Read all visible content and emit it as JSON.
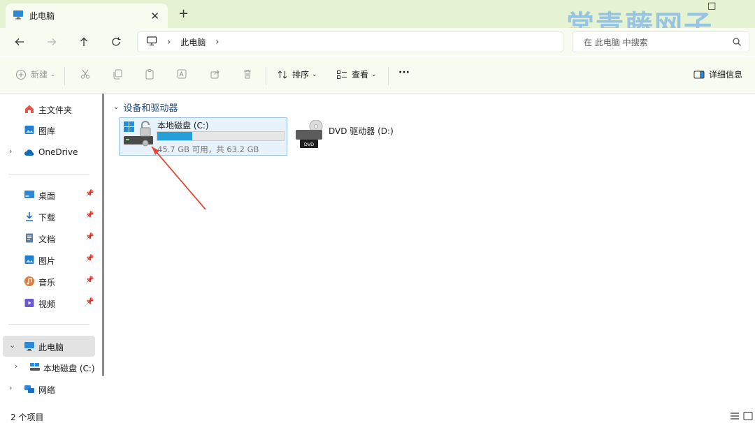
{
  "tab": {
    "title": "此电脑",
    "close": "✕",
    "add": "+"
  },
  "window": {
    "maximize": "☐"
  },
  "watermark": "常青藤网子",
  "address": {
    "sep1": "›",
    "crumb": "此电脑",
    "sep2": "›"
  },
  "search": {
    "placeholder": "在 此电脑 中搜索"
  },
  "toolbar": {
    "new_label": "新建",
    "sort_label": "排序",
    "view_label": "查看",
    "more_label": "···",
    "details_label": "详细信息"
  },
  "sidebar": {
    "home": "主文件夹",
    "gallery": "图库",
    "onedrive": "OneDrive",
    "quick": [
      {
        "label": "桌面"
      },
      {
        "label": "下载"
      },
      {
        "label": "文档"
      },
      {
        "label": "图片"
      },
      {
        "label": "音乐"
      },
      {
        "label": "视频"
      }
    ],
    "thispc": "此电脑",
    "local_disk": "本地磁盘 (C:)",
    "network": "网络"
  },
  "content": {
    "group_title": "设备和驱动器",
    "drive_c": {
      "name": "本地磁盘 (C:)",
      "free_text": "45.7 GB 可用，共 63.2 GB",
      "used_fraction": 0.277
    },
    "drive_d": {
      "name": "DVD 驱动器 (D:)",
      "badge": "DVD"
    }
  },
  "status": {
    "items": "2 个项目"
  },
  "colors": {
    "accent": "#26a0da",
    "chrome": "#e6f3d2",
    "group": "#1f4f86",
    "watermark": "#7cb4e6"
  }
}
